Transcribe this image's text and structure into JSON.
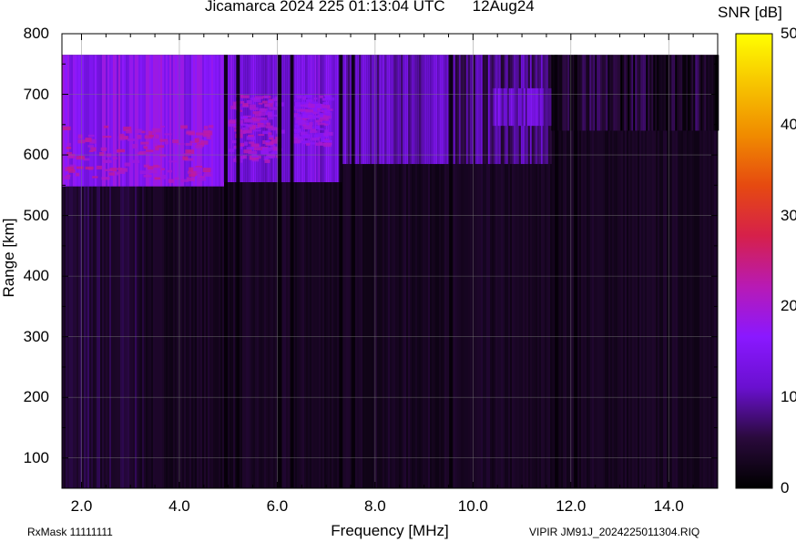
{
  "header": {
    "title": "Jicamarca 2024 225 01:13:04 UTC",
    "date": "12Aug24"
  },
  "footer": {
    "rxmask": "RxMask 11111111",
    "filename": "VIPIR  JM91J_2024225011304.RIQ"
  },
  "chart_data": {
    "type": "heatmap",
    "title": "Jicamarca 2024 225 01:13:04 UTC",
    "xlabel": "Frequency [MHz]",
    "ylabel": "Range [km]",
    "xlim": [
      1.6,
      15.0
    ],
    "ylim": [
      50,
      800
    ],
    "x_ticks": [
      "2.0",
      "4.0",
      "6.0",
      "8.0",
      "10.0",
      "12.0",
      "14.0"
    ],
    "y_ticks": [
      "100",
      "200",
      "300",
      "400",
      "500",
      "600",
      "700",
      "800"
    ],
    "grid": true,
    "colorbar": {
      "label": "SNR [dB]",
      "range": [
        0,
        50
      ],
      "ticks": [
        "0",
        "10",
        "20",
        "30",
        "40",
        "50"
      ],
      "colors": [
        "#000000",
        "#2a0a3c",
        "#6a10d0",
        "#8a18ff",
        "#b81ab4",
        "#d6204a",
        "#e64a10",
        "#f08c00",
        "#f7c400",
        "#ffff00"
      ]
    },
    "data_top_km": 765,
    "echo_regions": [
      {
        "f_start": 1.6,
        "f_end": 4.9,
        "range_bottom": 548,
        "range_top": 765,
        "snr_db": 16
      },
      {
        "f_start": 4.9,
        "f_end": 7.3,
        "range_bottom": 555,
        "range_top": 765,
        "snr_db": 14
      },
      {
        "f_start": 7.3,
        "f_end": 9.6,
        "range_bottom": 585,
        "range_top": 765,
        "snr_db": 11
      },
      {
        "f_start": 9.6,
        "f_end": 11.6,
        "range_bottom": 585,
        "range_top": 765,
        "snr_db": 8
      },
      {
        "f_start": 10.4,
        "f_end": 11.6,
        "range_bottom": 648,
        "range_top": 710,
        "snr_db": 12
      },
      {
        "f_start": 11.6,
        "f_end": 15.0,
        "range_bottom": 640,
        "range_top": 765,
        "snr_db": 4
      }
    ],
    "strong_patches": [
      {
        "f_start": 1.6,
        "f_end": 4.6,
        "range_bottom": 560,
        "range_top": 650,
        "snr_db": 22
      },
      {
        "f_start": 5.0,
        "f_end": 6.0,
        "range_bottom": 590,
        "range_top": 700,
        "snr_db": 20
      },
      {
        "f_start": 6.3,
        "f_end": 7.0,
        "range_bottom": 620,
        "range_top": 700,
        "snr_db": 18
      }
    ],
    "dark_columns_mhz": [
      4.95,
      5.2,
      6.05,
      6.3,
      7.3,
      7.55,
      9.55,
      11.7,
      12.1
    ],
    "background_snr_db": 2
  }
}
